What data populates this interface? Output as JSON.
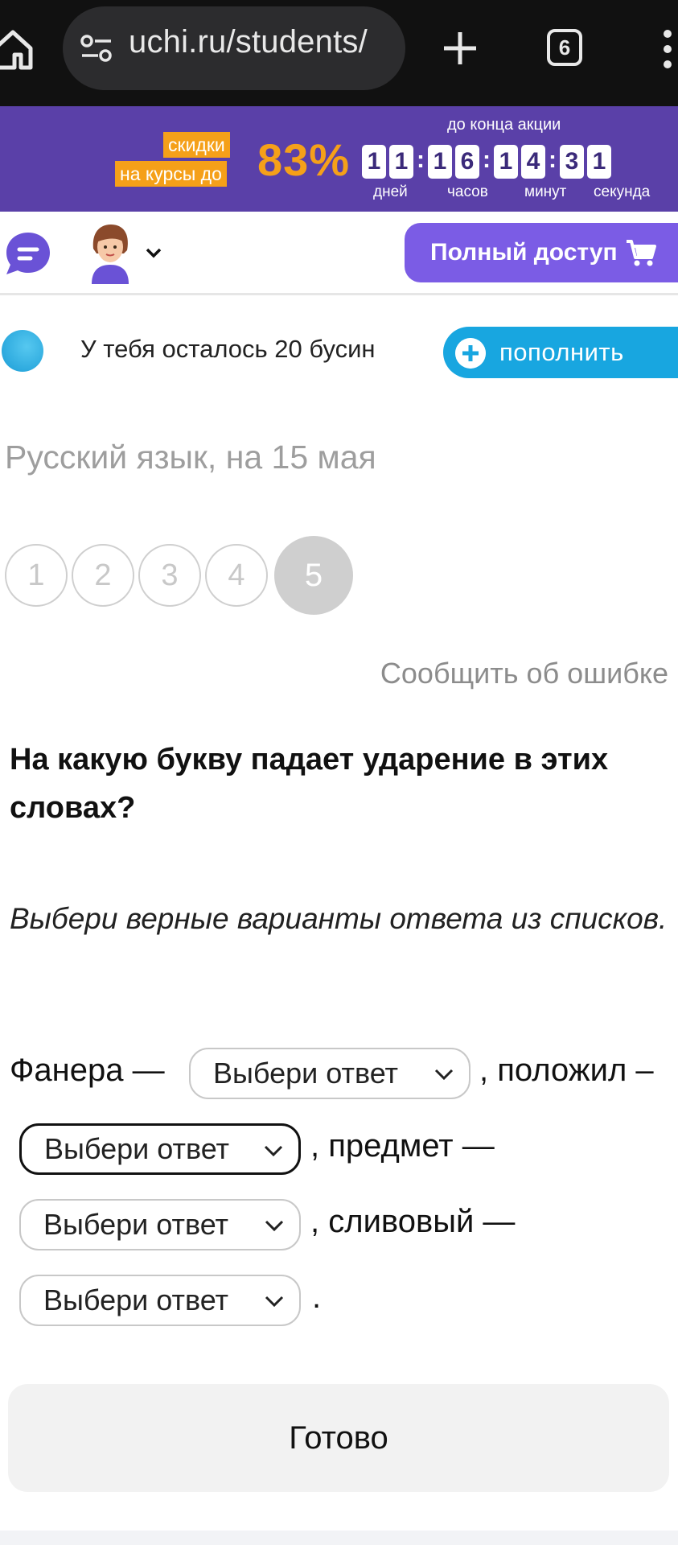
{
  "browser": {
    "url": "uchi.ru/students/",
    "tab_count": "6"
  },
  "promo": {
    "tag_line1": "скидки",
    "tag_line2": "на курсы до",
    "percent": "83%",
    "until": "до конца акции",
    "timer": {
      "days": [
        "1",
        "1"
      ],
      "hours": [
        "1",
        "6"
      ],
      "minutes": [
        "1",
        "4"
      ],
      "seconds": [
        "3",
        "1"
      ]
    },
    "labels": {
      "days": "дней",
      "hours": "часов",
      "minutes": "минут",
      "seconds": "секунда"
    }
  },
  "header": {
    "full_access": "Полный доступ"
  },
  "beads": {
    "text": "У тебя осталось 20 бусин",
    "refill": "пополнить"
  },
  "lesson": {
    "title": "Русский язык, на 15 мая",
    "steps": [
      "1",
      "2",
      "3",
      "4",
      "5"
    ],
    "active_step": 5,
    "report": "Сообщить об ошибке"
  },
  "question": {
    "text": "На какую букву падает ударение в этих словах?",
    "instruction": "Выбери верные варианты ответа из списков."
  },
  "exercise": {
    "word1": "Фанера —",
    "word2": ", положил –",
    "word3": ", предмет —",
    "word4": ", сливовый —",
    "end": ".",
    "placeholder": "Выбери ответ"
  },
  "done": "Готово"
}
